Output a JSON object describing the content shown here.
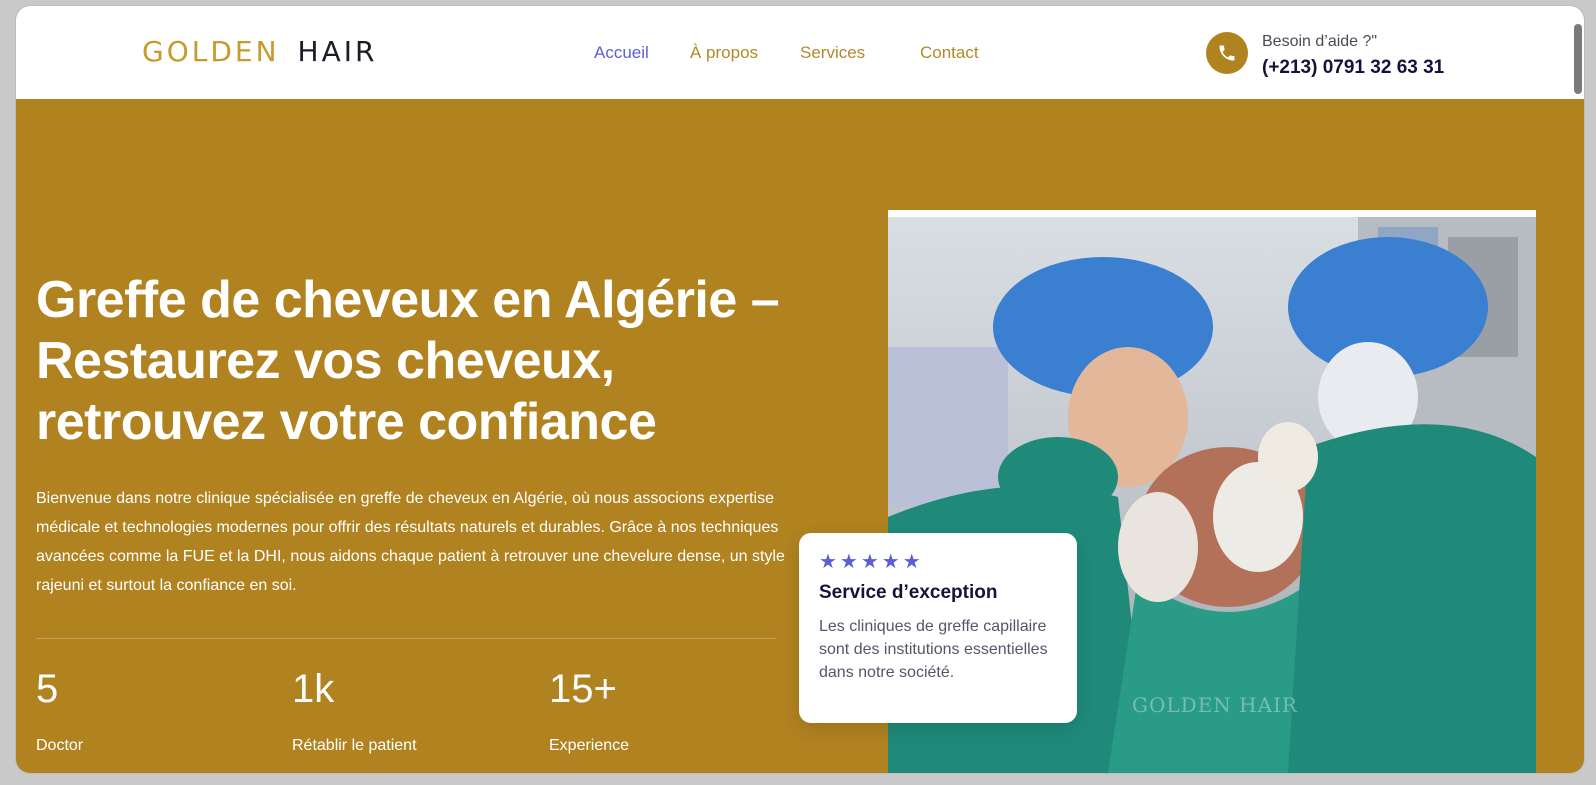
{
  "header": {
    "logo_gold": "GOLDEN",
    "logo_dark": "HAIR",
    "nav": [
      {
        "label": "Accueil"
      },
      {
        "label": "À propos"
      },
      {
        "label": "Services"
      },
      {
        "label": "Contact"
      }
    ],
    "help_label": "Besoin d’aide ?\"",
    "help_phone": "(+213) 0791 32 63 31",
    "phone_icon": "phone-icon"
  },
  "hero": {
    "title": "Greffe de cheveux en Algérie – Restaurez vos cheveux, retrouvez votre confiance",
    "text": "Bienvenue dans notre clinique spécialisée en greffe de cheveux en Algérie, où nous associons expertise médicale et technologies modernes pour offrir des résultats naturels et durables. Grâce à nos techniques avancées comme la FUE et la DHI, nous aidons chaque patient à retrouver une chevelure dense, un style rajeuni et surtout la confiance en soi.",
    "stats": [
      {
        "value": "5",
        "label": "Doctor"
      },
      {
        "value": "1k",
        "label": "Rétablir le patient"
      },
      {
        "value": "15+",
        "label": "Experience"
      }
    ]
  },
  "photo": {
    "watermark": "GOLDEN HAIR"
  },
  "review_card": {
    "stars": "★★★★★",
    "rating": 5,
    "title": "Service d’exception",
    "text": "Les cliniques de greffe capillaire sont des institutions essentielles dans notre société."
  },
  "colors": {
    "brand_gold": "#b08220",
    "accent_blue": "#5b5fd6",
    "dark_text": "#14143a"
  }
}
